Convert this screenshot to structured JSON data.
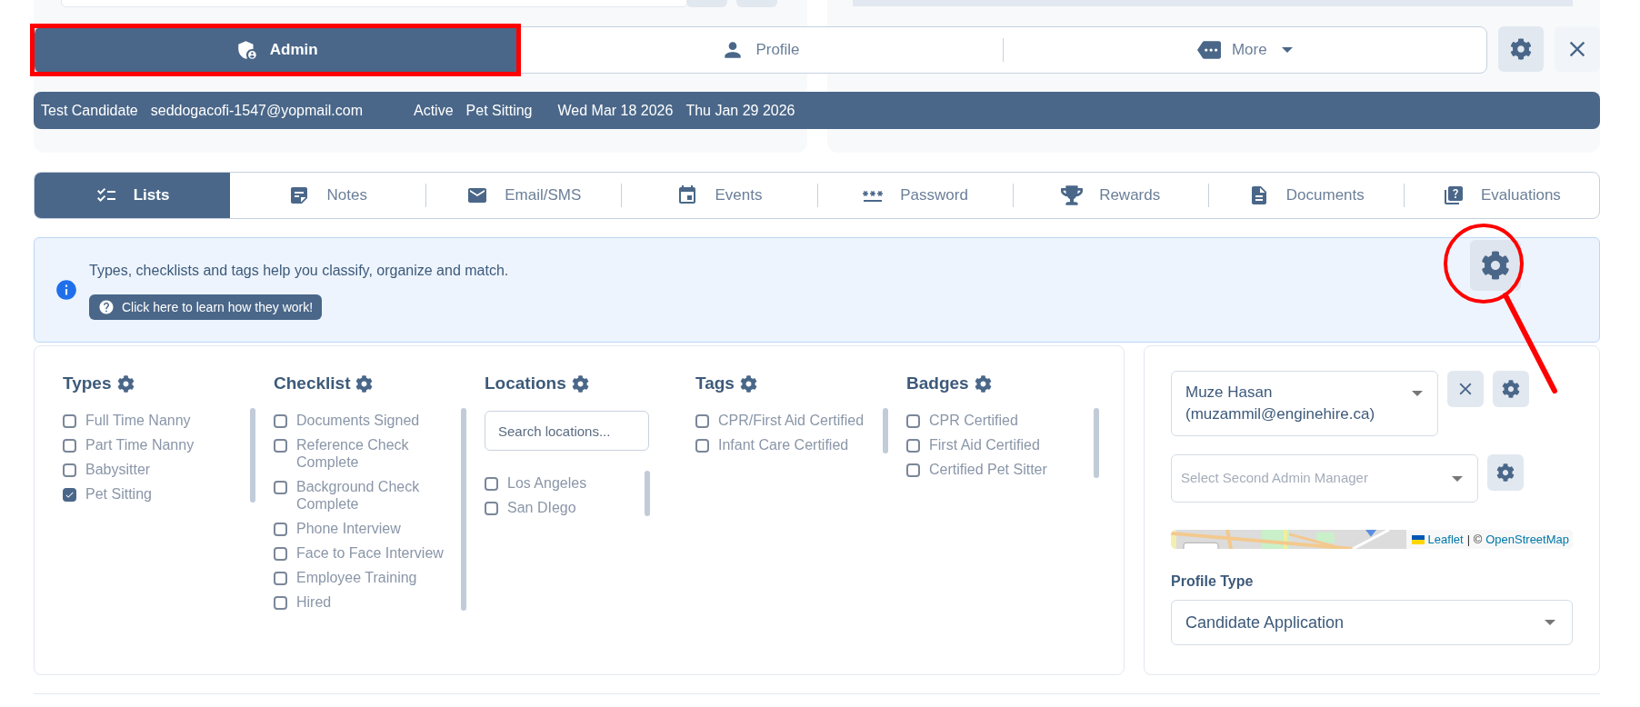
{
  "header_tabs": [
    {
      "label": "Admin",
      "selected": true
    },
    {
      "label": "Profile",
      "selected": false
    },
    {
      "label": "More",
      "selected": false
    }
  ],
  "summary": [
    "Test Candidate",
    "seddogacofi-1547@yopmail.com",
    "Active",
    "Pet Sitting",
    "Wed Mar 18 2026",
    "Thu Jan 29 2026"
  ],
  "tabs": [
    {
      "label": "Lists",
      "selected": true
    },
    {
      "label": "Notes",
      "selected": false
    },
    {
      "label": "Email/SMS",
      "selected": false
    },
    {
      "label": "Events",
      "selected": false
    },
    {
      "label": "Password",
      "selected": false
    },
    {
      "label": "Rewards",
      "selected": false
    },
    {
      "label": "Documents",
      "selected": false
    },
    {
      "label": "Evaluations",
      "selected": false
    }
  ],
  "info": {
    "message": "Types, checklists and tags help you classify, organize and match.",
    "button": "Click here to learn how they work!"
  },
  "lists": [
    {
      "title": "Types",
      "items": [
        {
          "label": "Full Time Nanny",
          "checked": false
        },
        {
          "label": "Part Time Nanny",
          "checked": false
        },
        {
          "label": "Babysitter",
          "checked": false
        },
        {
          "label": "Pet Sitting",
          "checked": true
        }
      ]
    },
    {
      "title": "Checklist",
      "items": [
        {
          "label": "Documents Signed",
          "checked": false
        },
        {
          "label": "Reference Check Complete",
          "checked": false
        },
        {
          "label": "Background Check Complete",
          "checked": false
        },
        {
          "label": "Phone Interview",
          "checked": false
        },
        {
          "label": "Face to Face Interview",
          "checked": false
        },
        {
          "label": "Employee Training",
          "checked": false
        },
        {
          "label": "Hired",
          "checked": false
        }
      ]
    },
    {
      "title": "Locations",
      "search_placeholder": "Search locations...",
      "items": [
        {
          "label": "Los Angeles",
          "checked": false
        },
        {
          "label": "San DIego",
          "checked": false
        }
      ]
    },
    {
      "title": "Tags",
      "items": [
        {
          "label": "CPR/First Aid Certified",
          "checked": false
        },
        {
          "label": "Infant Care Certified",
          "checked": false
        }
      ]
    },
    {
      "title": "Badges",
      "items": [
        {
          "label": "CPR Certified",
          "checked": false
        },
        {
          "label": "First Aid Certified",
          "checked": false
        },
        {
          "label": "Certified Pet Sitter",
          "checked": false
        }
      ]
    }
  ],
  "admin_manager": {
    "value": "Muze Hasan (muzammil@enginehire.ca)"
  },
  "second_admin_manager": {
    "placeholder": "Select Second Admin Manager"
  },
  "map": {
    "links": [
      "Leaflet",
      "OpenStreetMap"
    ],
    "separator": "| ©"
  },
  "profile_type": {
    "label": "Profile Type",
    "value": "Candidate Application"
  }
}
